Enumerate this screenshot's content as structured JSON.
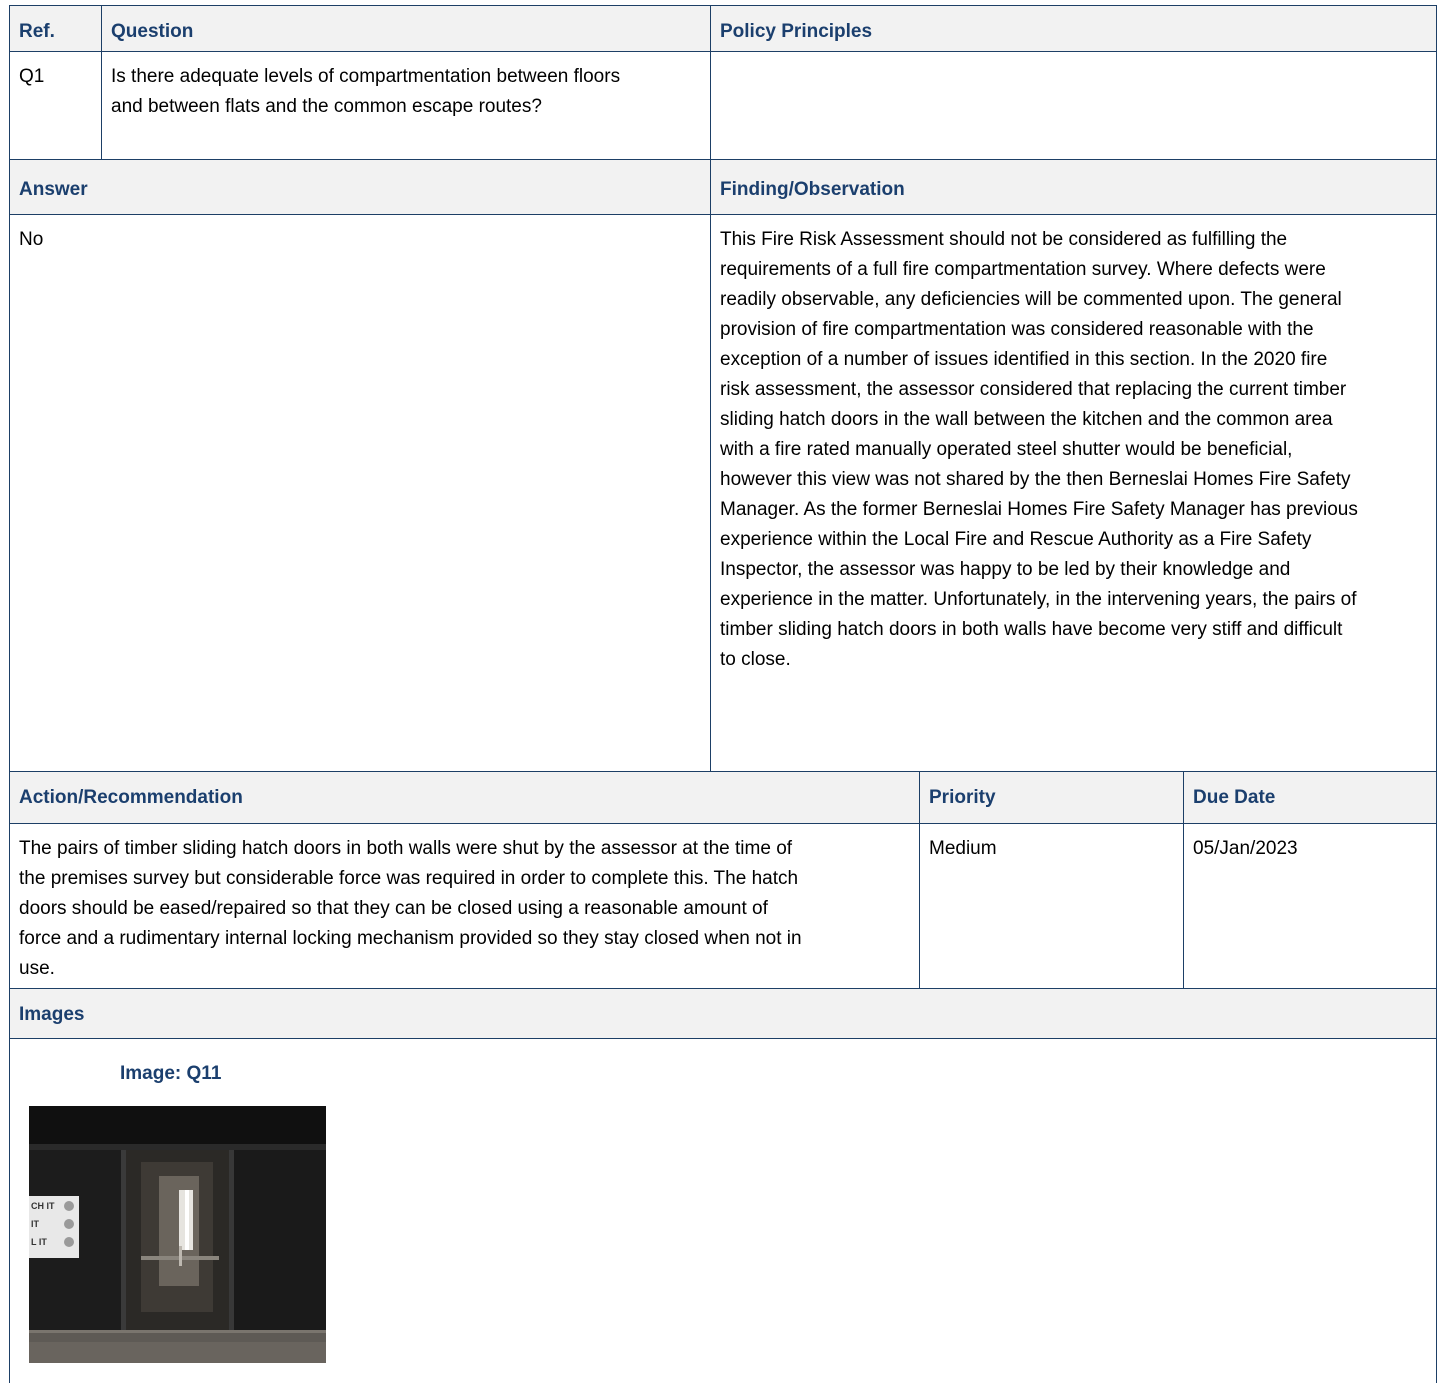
{
  "header": {
    "ref": "Ref.",
    "question": "Question",
    "policy": "Policy Principles"
  },
  "question_row": {
    "ref": "Q1",
    "question": "Is there adequate levels of compartmentation between floors and between flats and the common escape routes?",
    "policy": ""
  },
  "answer_header": {
    "answer": "Answer",
    "finding": "Finding/Observation"
  },
  "answer_row": {
    "answer": "No",
    "finding": "This Fire Risk Assessment should not be considered as fulfilling the requirements of a full fire compartmentation survey. Where defects were readily observable, any deficiencies will be commented upon. The general provision of fire compartmentation was considered reasonable with the exception of a number of issues identified in this section. In the 2020 fire risk assessment, the assessor considered that replacing the current timber sliding hatch doors in the wall between the kitchen and the common area with a fire rated manually operated steel shutter would be beneficial, however this view was not shared by the then Berneslai Homes Fire Safety Manager. As the former Berneslai Homes Fire Safety Manager has previous experience within the Local Fire and Rescue Authority as a Fire Safety Inspector, the assessor was happy to be led by their knowledge and experience in the matter. Unfortunately, in the intervening years, the pairs of timber sliding hatch doors in both walls have become very stiff and difficult to close."
  },
  "action_header": {
    "action": "Action/Recommendation",
    "priority": "Priority",
    "due": "Due Date"
  },
  "action_row": {
    "action": "The pairs of timber sliding hatch doors in both walls were shut by the assessor at the time of the premises survey but considerable force was required in order to complete this. The hatch doors should be eased/repaired so that they can be closed using a reasonable amount of force and a rudimentary internal locking mechanism provided so they stay closed when not in use.",
    "priority": "Medium",
    "due": "05/Jan/2023"
  },
  "images_section": {
    "header": "Images",
    "image_title": "Image: Q11",
    "photo_sign_lines": [
      "CH IT",
      "IT",
      "L IT"
    ]
  }
}
